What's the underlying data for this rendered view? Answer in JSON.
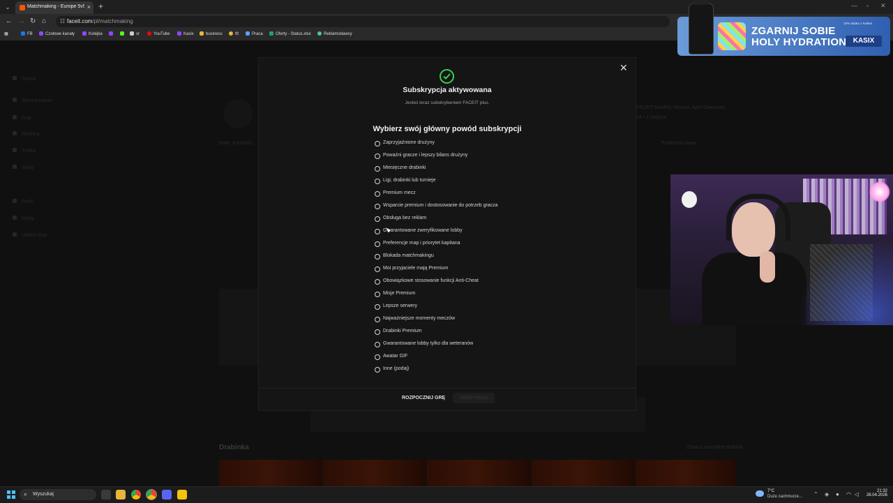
{
  "browser": {
    "tab_title": "Matchmaking - Europe 5v5 Qu",
    "url_host": "faceit.com",
    "url_path": "/pl/matchmaking",
    "bookmarks": [
      "FB",
      "Czołowe kanały",
      "Kolejka",
      "",
      "",
      "sr",
      "YouTube",
      "Kasix",
      "business",
      "tft",
      "Praca",
      "Oferty - Status.xlsx",
      "Reklamodawcy"
    ]
  },
  "ad": {
    "line1": "ZGARNIJ SOBIE",
    "line2": "HOLY HYDRATION",
    "code": "KASIX",
    "fineprint": "10% rabatu z kodem"
  },
  "modal": {
    "title": "Subskrypcja aktywowana",
    "subtitle": "Jesteś teraz subskrybentem FACEIT plus.",
    "question": "Wybierz swój główny powód subskrypcji",
    "options": [
      "Zaprzyjaźnione drużyny",
      "Poważni gracze i lepszy bilans drużyny",
      "Miesięczne drabinki",
      "Ligi, drabinki lub turnieje",
      "Premium mecz",
      "Wsparcie premium i dostosowanie do potrzeb gracza",
      "Obsługa bez reklam",
      "Gwarantowane zweryfikowane lobby",
      "Preferencje map i priorytet kapitana",
      "Blokada matchmakingu",
      "Moi przyjaciele mają Premium",
      "Obowiązkowe stosowanie funkcji Anti-Cheat",
      "Misje Premium",
      "Lepsze serwery",
      "Najważniejsze momenty meczów",
      "Drabinki Premium",
      "Gwarantowane lobby tylko dla weteranów",
      "Awatar GIF",
      "Inne (podaj)"
    ],
    "start_label": "ROZPOCZNIJ GRĘ",
    "continue_label": "KONTYNUUJ"
  },
  "background": {
    "sidebar_items": [
      "Strona",
      "Wyszukiwanie",
      "Graj",
      "Ranking",
      "Trofea",
      "Sklep",
      "Profil",
      "Kluby",
      "Utwórz klub"
    ],
    "player_name": "team_Kasix001",
    "event_title": "FACEIT Monthly Mission: April Giveaway",
    "event_meta": "24 • 1 miejsce",
    "ladder_heading": "Drabinka",
    "ladder_link": "Zobacz wszystkie drabinki",
    "status_label": "Publiczna sława"
  },
  "taskbar": {
    "search_placeholder": "Wyszukaj",
    "weather_temp": "7°C",
    "weather_desc": "Duże zachmurze...",
    "time": "21:32",
    "date": "28.04.2026"
  },
  "colors": {
    "accent_check": "#3ccf4e",
    "faceit_orange": "#ff5500",
    "ad_blue": "#2f5fb0"
  }
}
